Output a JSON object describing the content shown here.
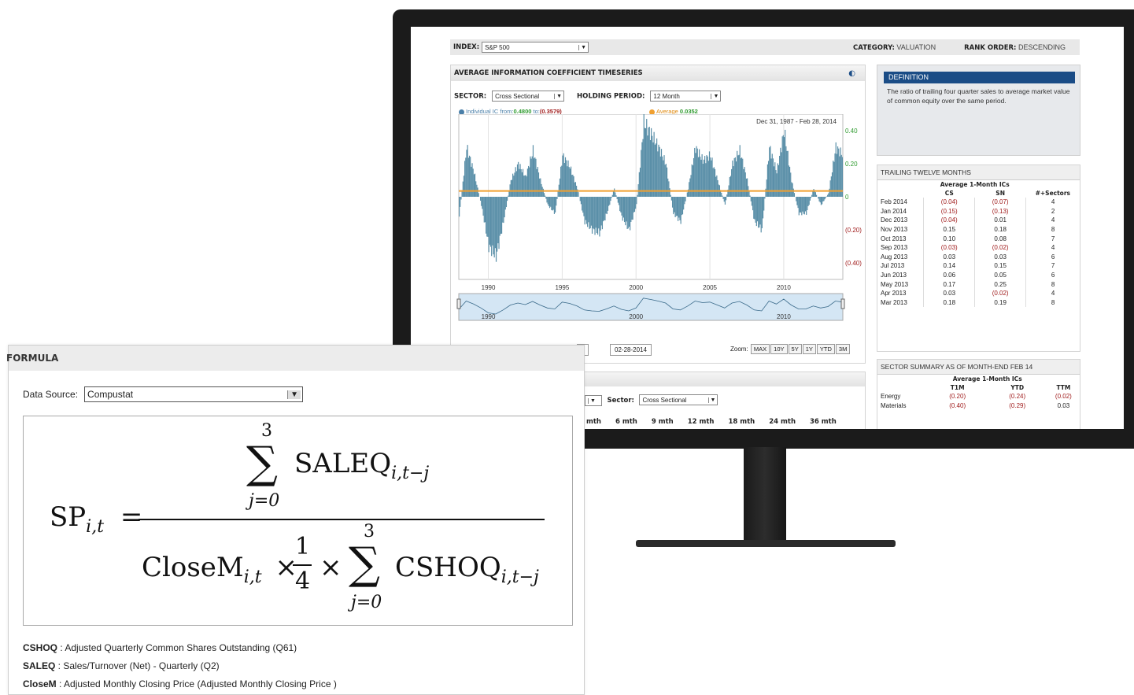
{
  "top": {
    "index_label": "INDEX:",
    "index_value": "S&P 500",
    "category_label": "CATEGORY:",
    "category_value": "VALUATION",
    "rank_label": "RANK ORDER:",
    "rank_value": "DESCENDING"
  },
  "chart_panel": {
    "title": "AVERAGE INFORMATION COEFFICIENT TIMESERIES",
    "sector_label": "SECTOR:",
    "sector_value": "Cross Sectional",
    "holding_label": "HOLDING PERIOD:",
    "holding_value": "12 Month",
    "legend_ic": "Individual IC",
    "legend_from_label": "from:",
    "legend_from_value": "0.4800",
    "legend_to_label": "to:",
    "legend_to_value": "(0.3579)",
    "legend_avg": "Average",
    "legend_avg_value": "0.0352",
    "date_range": "Dec 31, 1987 - Feb 28, 2014",
    "end_date": "02-28-2014",
    "start_date_fragment": "7",
    "zoom_label": "Zoom:",
    "zoom_buttons": [
      "MAX",
      "10Y",
      "5Y",
      "1Y",
      "YTD",
      "3M"
    ],
    "nav_years": [
      "1990",
      "2000",
      "2010"
    ]
  },
  "chart_data": {
    "type": "bar",
    "x_range": [
      1988,
      2014
    ],
    "ylim": [
      -0.5,
      0.5
    ],
    "y_ticks": [
      "0.40",
      "0.20",
      "0",
      "(0.20)",
      "(0.40)"
    ],
    "x_ticks": [
      "1990",
      "1995",
      "2000",
      "2005",
      "2010"
    ],
    "average": 0.0352,
    "series": [
      {
        "x": [
          1988.0,
          1988.5,
          1989.0,
          1989.5,
          1990.0,
          1990.5,
          1991.0,
          1991.5,
          1992.0,
          1992.5,
          1993.0,
          1993.5,
          1994.0,
          1994.5,
          1995.0,
          1995.5,
          1996.0,
          1996.5,
          1997.0,
          1997.5,
          1998.0,
          1998.5,
          1999.0,
          1999.5,
          2000.0,
          2000.5,
          2001.0,
          2001.5,
          2002.0,
          2002.5,
          2003.0,
          2003.5,
          2004.0,
          2004.5,
          2005.0,
          2005.5,
          2006.0,
          2006.5,
          2007.0,
          2007.5,
          2008.0,
          2008.5,
          2009.0,
          2009.5,
          2010.0,
          2010.5,
          2011.0,
          2011.5,
          2012.0,
          2012.5,
          2013.0,
          2013.5,
          2014.0
        ],
        "values": [
          -0.12,
          0.3,
          0.15,
          -0.05,
          -0.3,
          -0.36,
          -0.15,
          0.1,
          0.2,
          0.12,
          0.28,
          0.1,
          -0.05,
          -0.1,
          0.25,
          0.18,
          0.05,
          -0.15,
          -0.2,
          -0.22,
          -0.1,
          0.05,
          -0.12,
          -0.2,
          -0.05,
          0.45,
          0.38,
          0.3,
          0.2,
          -0.1,
          -0.15,
          0.05,
          0.3,
          0.22,
          0.25,
          0.1,
          -0.05,
          0.2,
          0.28,
          0.1,
          -0.15,
          -0.2,
          0.3,
          0.15,
          0.4,
          0.1,
          -0.1,
          -0.1,
          0.05,
          -0.05,
          0.02,
          0.3,
          0.25
        ]
      }
    ]
  },
  "definition": {
    "title": "DEFINITION",
    "text": "The ratio of trailing four quarter sales to average market value of common equity over the same period."
  },
  "ttm": {
    "title": "TRAILING TWELVE MONTHS",
    "group_header": "Average 1-Month ICs",
    "columns": [
      "CS",
      "SN",
      "#+Sectors"
    ],
    "rows": [
      {
        "label": "Feb 2014",
        "cs": "(0.04)",
        "sn": "(0.07)",
        "n": "4"
      },
      {
        "label": "Jan 2014",
        "cs": "(0.15)",
        "sn": "(0.13)",
        "n": "2"
      },
      {
        "label": "Dec 2013",
        "cs": "(0.04)",
        "sn": "0.01",
        "n": "4"
      },
      {
        "label": "Nov 2013",
        "cs": "0.15",
        "sn": "0.18",
        "n": "8"
      },
      {
        "label": "Oct 2013",
        "cs": "0.10",
        "sn": "0.08",
        "n": "7"
      },
      {
        "label": "Sep 2013",
        "cs": "(0.03)",
        "sn": "(0.02)",
        "n": "4"
      },
      {
        "label": "Aug 2013",
        "cs": "0.03",
        "sn": "0.03",
        "n": "6"
      },
      {
        "label": "Jul 2013",
        "cs": "0.14",
        "sn": "0.15",
        "n": "7"
      },
      {
        "label": "Jun 2013",
        "cs": "0.06",
        "sn": "0.05",
        "n": "6"
      },
      {
        "label": "May 2013",
        "cs": "0.17",
        "sn": "0.25",
        "n": "8"
      },
      {
        "label": "Apr 2013",
        "cs": "0.03",
        "sn": "(0.02)",
        "n": "4"
      },
      {
        "label": "Mar 2013",
        "cs": "0.18",
        "sn": "0.19",
        "n": "8"
      }
    ]
  },
  "sector_summary": {
    "title": "SECTOR SUMMARY AS OF MONTH-END FEB 14",
    "group_header": "Average 1-Month ICs",
    "columns": [
      "T1M",
      "YTD",
      "TTM"
    ],
    "rows": [
      {
        "label": "Energy",
        "t1m": "(0.20)",
        "ytd": "(0.24)",
        "ttm": "(0.02)"
      },
      {
        "label": "Materials",
        "t1m": "(0.40)",
        "ytd": "(0.29)",
        "ttm": "0.03"
      }
    ]
  },
  "bottom_panel": {
    "sector_label": "Sector:",
    "sector_value": "Cross Sectional",
    "periods": [
      "mth",
      "6 mth",
      "9 mth",
      "12 mth",
      "18 mth",
      "24 mth",
      "36 mth"
    ]
  },
  "formula": {
    "title": "FORMULA",
    "data_source_label": "Data Source:",
    "data_source_value": "Compustat",
    "lhs": "SP",
    "lhs_sub": "i,t",
    "num_var": "SALEQ",
    "num_sub": "i,t−j",
    "sum_top": "3",
    "sum_bottom": "j=0",
    "den_var1": "CloseM",
    "den_sub1": "i,t",
    "den_frac_num": "1",
    "den_frac_den": "4",
    "den_var2": "CSHOQ",
    "den_sub2": "i,t−j",
    "definitions": [
      {
        "term": "CSHOQ",
        "desc": " : Adjusted Quarterly Common Shares Outstanding (Q61)"
      },
      {
        "term": "SALEQ",
        "desc": " : Sales/Turnover (Net) - Quarterly (Q2)"
      },
      {
        "term": "CloseM",
        "desc": " : Adjusted Monthly Closing Price (Adjusted Monthly Closing Price )"
      }
    ]
  },
  "colors": {
    "bar": "#5a8fa8",
    "average_line": "#f0a030",
    "negative": "#a01c1c",
    "positive_axis": "#2e9a2e",
    "definition_head": "#1a4c86"
  }
}
